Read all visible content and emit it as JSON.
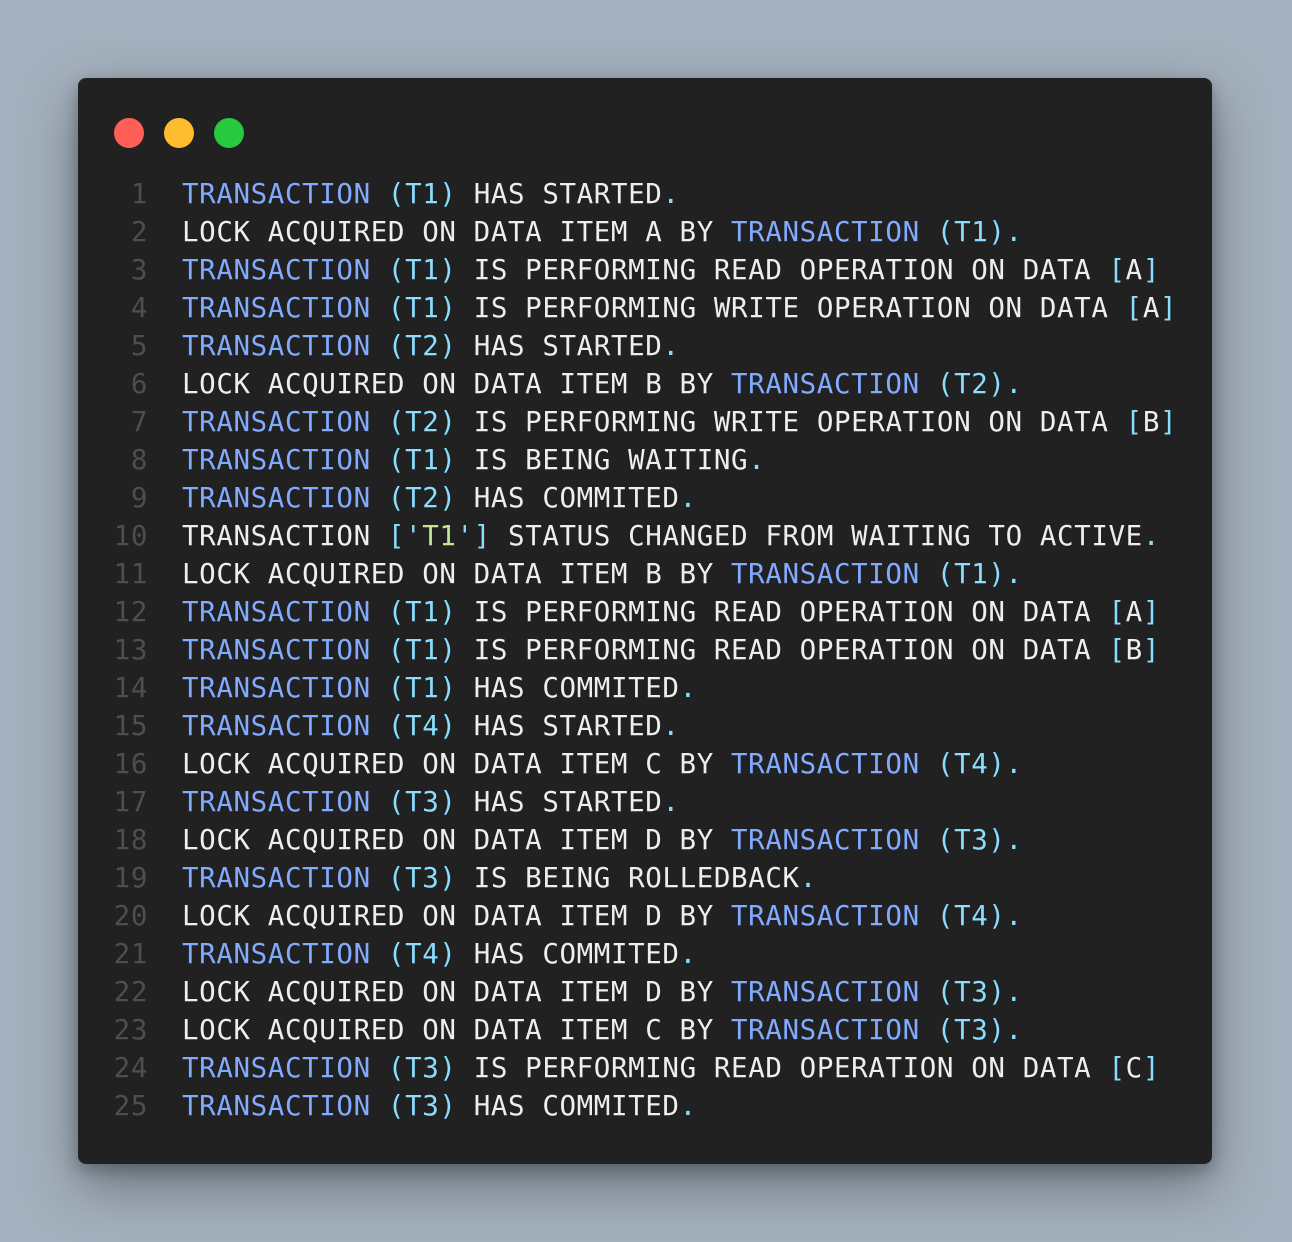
{
  "colors": {
    "background": "#a4b0bd",
    "window": "#212121",
    "line_number": "#4e4e4e",
    "plain": "#eeeeee",
    "keyword": "#82aaff",
    "punct": "#89ddff",
    "string": "#c3e88d",
    "dot_red": "#ff5f56",
    "dot_yellow": "#ffbd2e",
    "dot_green": "#27c93f"
  },
  "window_controls": [
    "close",
    "minimize",
    "maximize"
  ],
  "lines": [
    {
      "n": "1",
      "tokens": [
        [
          "k",
          "TRANSACTION"
        ],
        [
          "p",
          " "
        ],
        [
          "c",
          "(T1)"
        ],
        [
          "p",
          " HAS STARTED"
        ],
        [
          "c",
          "."
        ]
      ]
    },
    {
      "n": "2",
      "tokens": [
        [
          "p",
          "LOCK ACQUIRED ON DATA ITEM A BY "
        ],
        [
          "k",
          "TRANSACTION"
        ],
        [
          "p",
          " "
        ],
        [
          "c",
          "(T1)."
        ]
      ]
    },
    {
      "n": "3",
      "tokens": [
        [
          "k",
          "TRANSACTION"
        ],
        [
          "p",
          " "
        ],
        [
          "c",
          "(T1)"
        ],
        [
          "p",
          " IS PERFORMING READ OPERATION ON DATA "
        ],
        [
          "c",
          "["
        ],
        [
          "p",
          "A"
        ],
        [
          "c",
          "]"
        ]
      ]
    },
    {
      "n": "4",
      "tokens": [
        [
          "k",
          "TRANSACTION"
        ],
        [
          "p",
          " "
        ],
        [
          "c",
          "(T1)"
        ],
        [
          "p",
          " IS PERFORMING WRITE OPERATION ON DATA "
        ],
        [
          "c",
          "["
        ],
        [
          "p",
          "A"
        ],
        [
          "c",
          "]"
        ]
      ]
    },
    {
      "n": "5",
      "tokens": [
        [
          "k",
          "TRANSACTION"
        ],
        [
          "p",
          " "
        ],
        [
          "c",
          "(T2)"
        ],
        [
          "p",
          " HAS STARTED"
        ],
        [
          "c",
          "."
        ]
      ]
    },
    {
      "n": "6",
      "tokens": [
        [
          "p",
          "LOCK ACQUIRED ON DATA ITEM B BY "
        ],
        [
          "k",
          "TRANSACTION"
        ],
        [
          "p",
          " "
        ],
        [
          "c",
          "(T2)."
        ]
      ]
    },
    {
      "n": "7",
      "tokens": [
        [
          "k",
          "TRANSACTION"
        ],
        [
          "p",
          " "
        ],
        [
          "c",
          "(T2)"
        ],
        [
          "p",
          " IS PERFORMING WRITE OPERATION ON DATA "
        ],
        [
          "c",
          "["
        ],
        [
          "p",
          "B"
        ],
        [
          "c",
          "]"
        ]
      ]
    },
    {
      "n": "8",
      "tokens": [
        [
          "k",
          "TRANSACTION"
        ],
        [
          "p",
          " "
        ],
        [
          "c",
          "(T1)"
        ],
        [
          "p",
          " IS BEING WAITING"
        ],
        [
          "c",
          "."
        ]
      ]
    },
    {
      "n": "9",
      "tokens": [
        [
          "k",
          "TRANSACTION"
        ],
        [
          "p",
          " "
        ],
        [
          "c",
          "(T2)"
        ],
        [
          "p",
          " HAS COMMITED"
        ],
        [
          "c",
          "."
        ]
      ]
    },
    {
      "n": "10",
      "tokens": [
        [
          "p",
          "TRANSACTION "
        ],
        [
          "c",
          "['"
        ],
        [
          "s",
          "T1"
        ],
        [
          "c",
          "']"
        ],
        [
          "p",
          " STATUS CHANGED FROM WAITING TO ACTIVE"
        ],
        [
          "c",
          "."
        ]
      ]
    },
    {
      "n": "11",
      "tokens": [
        [
          "p",
          "LOCK ACQUIRED ON DATA ITEM B BY "
        ],
        [
          "k",
          "TRANSACTION"
        ],
        [
          "p",
          " "
        ],
        [
          "c",
          "(T1)."
        ]
      ]
    },
    {
      "n": "12",
      "tokens": [
        [
          "k",
          "TRANSACTION"
        ],
        [
          "p",
          " "
        ],
        [
          "c",
          "(T1)"
        ],
        [
          "p",
          " IS PERFORMING READ OPERATION ON DATA "
        ],
        [
          "c",
          "["
        ],
        [
          "p",
          "A"
        ],
        [
          "c",
          "]"
        ]
      ]
    },
    {
      "n": "13",
      "tokens": [
        [
          "k",
          "TRANSACTION"
        ],
        [
          "p",
          " "
        ],
        [
          "c",
          "(T1)"
        ],
        [
          "p",
          " IS PERFORMING READ OPERATION ON DATA "
        ],
        [
          "c",
          "["
        ],
        [
          "p",
          "B"
        ],
        [
          "c",
          "]"
        ]
      ]
    },
    {
      "n": "14",
      "tokens": [
        [
          "k",
          "TRANSACTION"
        ],
        [
          "p",
          " "
        ],
        [
          "c",
          "(T1)"
        ],
        [
          "p",
          " HAS COMMITED"
        ],
        [
          "c",
          "."
        ]
      ]
    },
    {
      "n": "15",
      "tokens": [
        [
          "k",
          "TRANSACTION"
        ],
        [
          "p",
          " "
        ],
        [
          "c",
          "(T4)"
        ],
        [
          "p",
          " HAS STARTED"
        ],
        [
          "c",
          "."
        ]
      ]
    },
    {
      "n": "16",
      "tokens": [
        [
          "p",
          "LOCK ACQUIRED ON DATA ITEM C BY "
        ],
        [
          "k",
          "TRANSACTION"
        ],
        [
          "p",
          " "
        ],
        [
          "c",
          "(T4)."
        ]
      ]
    },
    {
      "n": "17",
      "tokens": [
        [
          "k",
          "TRANSACTION"
        ],
        [
          "p",
          " "
        ],
        [
          "c",
          "(T3)"
        ],
        [
          "p",
          " HAS STARTED"
        ],
        [
          "c",
          "."
        ]
      ]
    },
    {
      "n": "18",
      "tokens": [
        [
          "p",
          "LOCK ACQUIRED ON DATA ITEM D BY "
        ],
        [
          "k",
          "TRANSACTION"
        ],
        [
          "p",
          " "
        ],
        [
          "c",
          "(T3)."
        ]
      ]
    },
    {
      "n": "19",
      "tokens": [
        [
          "k",
          "TRANSACTION"
        ],
        [
          "p",
          " "
        ],
        [
          "c",
          "(T3)"
        ],
        [
          "p",
          " IS BEING ROLLEDBACK"
        ],
        [
          "c",
          "."
        ]
      ]
    },
    {
      "n": "20",
      "tokens": [
        [
          "p",
          "LOCK ACQUIRED ON DATA ITEM D BY "
        ],
        [
          "k",
          "TRANSACTION"
        ],
        [
          "p",
          " "
        ],
        [
          "c",
          "(T4)."
        ]
      ]
    },
    {
      "n": "21",
      "tokens": [
        [
          "k",
          "TRANSACTION"
        ],
        [
          "p",
          " "
        ],
        [
          "c",
          "(T4)"
        ],
        [
          "p",
          " HAS COMMITED"
        ],
        [
          "c",
          "."
        ]
      ]
    },
    {
      "n": "22",
      "tokens": [
        [
          "p",
          "LOCK ACQUIRED ON DATA ITEM D BY "
        ],
        [
          "k",
          "TRANSACTION"
        ],
        [
          "p",
          " "
        ],
        [
          "c",
          "(T3)."
        ]
      ]
    },
    {
      "n": "23",
      "tokens": [
        [
          "p",
          "LOCK ACQUIRED ON DATA ITEM C BY "
        ],
        [
          "k",
          "TRANSACTION"
        ],
        [
          "p",
          " "
        ],
        [
          "c",
          "(T3)."
        ]
      ]
    },
    {
      "n": "24",
      "tokens": [
        [
          "k",
          "TRANSACTION"
        ],
        [
          "p",
          " "
        ],
        [
          "c",
          "(T3)"
        ],
        [
          "p",
          " IS PERFORMING READ OPERATION ON DATA "
        ],
        [
          "c",
          "["
        ],
        [
          "p",
          "C"
        ],
        [
          "c",
          "]"
        ]
      ]
    },
    {
      "n": "25",
      "tokens": [
        [
          "k",
          "TRANSACTION"
        ],
        [
          "p",
          " "
        ],
        [
          "c",
          "(T3)"
        ],
        [
          "p",
          " HAS COMMITED"
        ],
        [
          "c",
          "."
        ]
      ]
    }
  ]
}
